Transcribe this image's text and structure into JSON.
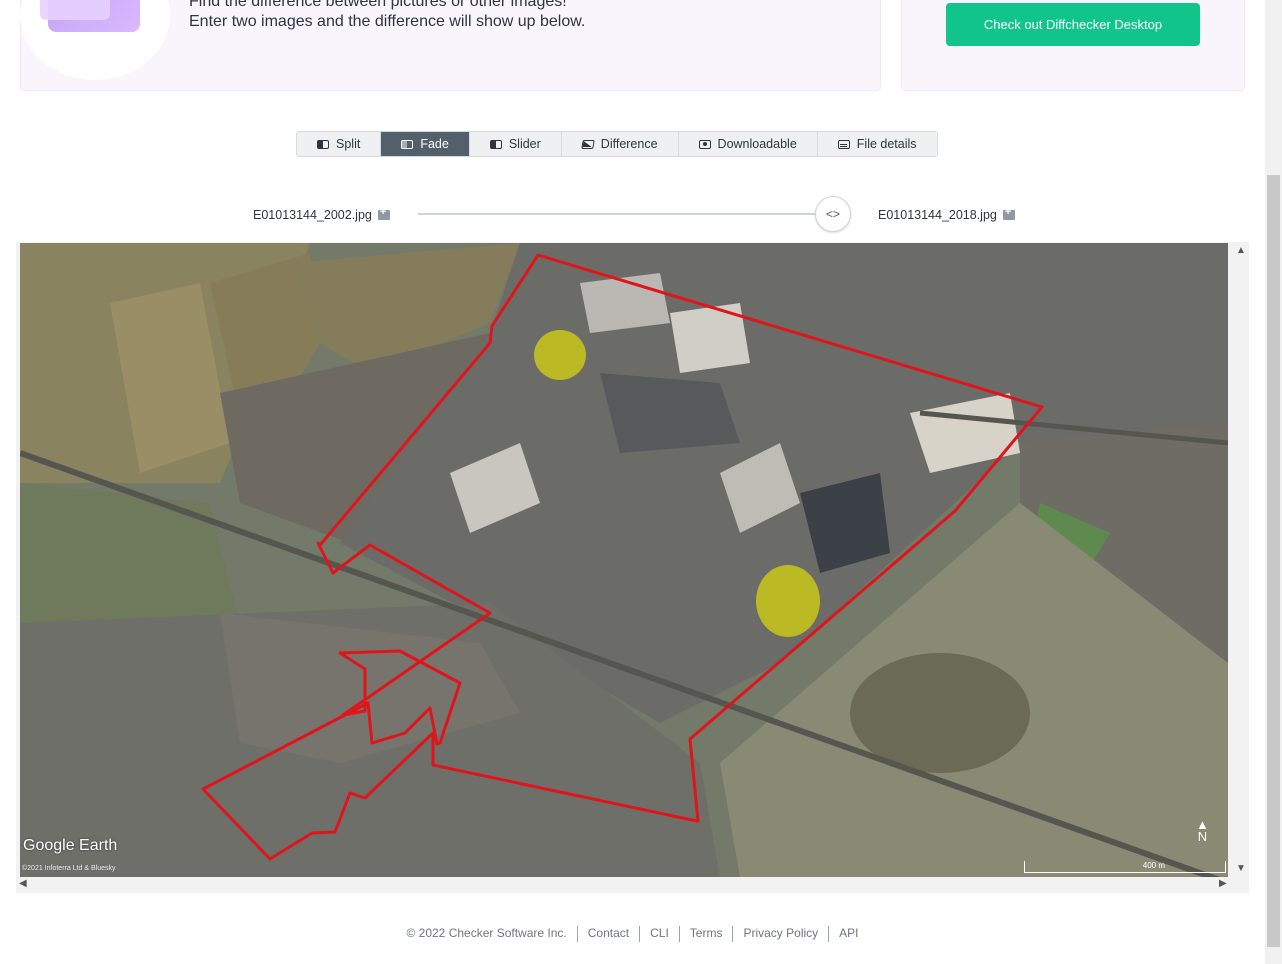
{
  "banner": {
    "line1": "Find the difference between pictures or other images!",
    "line2": "Enter two images and the difference will show up below.",
    "cta_label": "Check out Diffchecker Desktop",
    "cta_color": "#10c48a"
  },
  "tabs": [
    {
      "label": "Split",
      "icon": "split-view-icon"
    },
    {
      "label": "Fade",
      "icon": "fade-view-icon",
      "active": true
    },
    {
      "label": "Slider",
      "icon": "slider-view-icon"
    },
    {
      "label": "Difference",
      "icon": "difference-view-icon"
    },
    {
      "label": "Downloadable",
      "icon": "camera-icon"
    },
    {
      "label": "File details",
      "icon": "file-details-icon"
    }
  ],
  "files": {
    "left": "E01013144_2002.jpg",
    "right": "E01013144_2018.jpg"
  },
  "slider": {
    "position_fraction": 0.98
  },
  "map": {
    "logo": "Google Earth",
    "credit": "©2021 Infoterra Ltd & Bluesky",
    "scale": "400 m",
    "north": "N",
    "boundary_color": "#e0141b",
    "highlight_color": "#e7e400"
  },
  "footer": {
    "copyright": "© 2022 Checker Software Inc.",
    "links": [
      "Contact",
      "CLI",
      "Terms",
      "Privacy Policy",
      "API"
    ]
  },
  "accent_colors": {
    "active_tab": "#52606b",
    "cta": "#10c48a"
  }
}
